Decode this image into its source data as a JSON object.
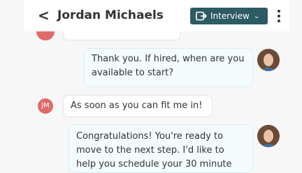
{
  "header": {
    "back_label": "<",
    "contact_name": "Jordan Michaels",
    "tag_label": "Interview",
    "tag_color": "#2d5b63"
  },
  "messages": [
    {
      "from": "recruiter",
      "text": "Thank you. If hired, when are you available to start?"
    },
    {
      "from": "candidate",
      "initials": "JM",
      "text": "As soon as you can fit me in!"
    },
    {
      "from": "recruiter",
      "text": "Congratulations! You're ready to move to the next step. I'd like to help you schedule your 30 minute"
    }
  ],
  "colors": {
    "outgoing_bubble": "#f3fbfd",
    "candidate_avatar": "#e06a6a"
  }
}
